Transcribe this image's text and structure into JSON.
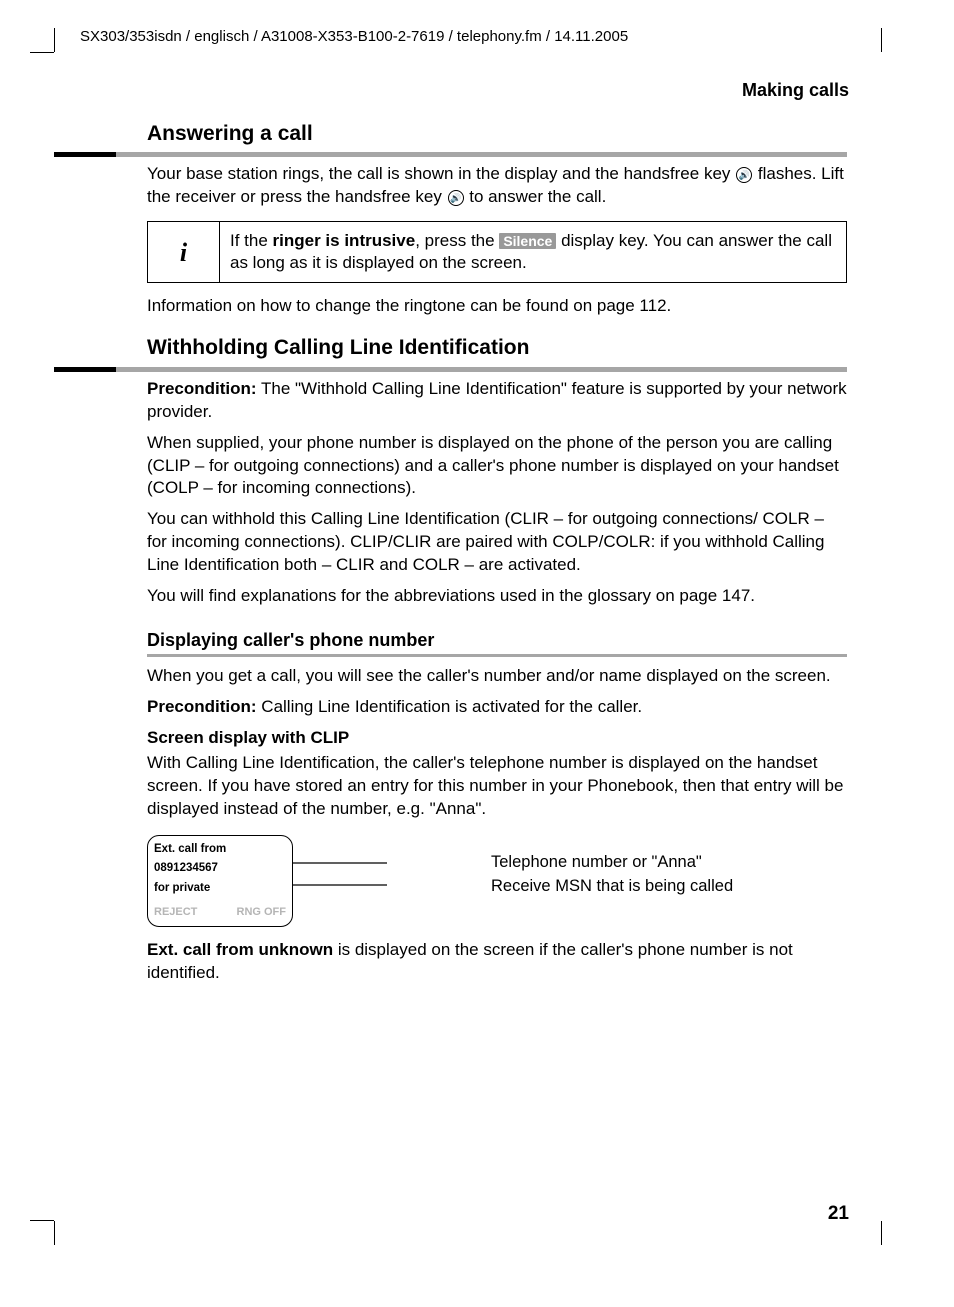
{
  "doc_header": "SX303/353isdn / englisch / A31008-X353-B100-2-7619 / telephony.fm / 14.11.2005",
  "chapter_title": "Making calls",
  "sec1": {
    "heading": "Answering a call",
    "p1a": "Your base station rings, the call is shown in the display and the handsfree key ",
    "p1b": " flashes. Lift the receiver or press the handsfree key ",
    "p1c": " to answer the call.",
    "info_a": "If the ",
    "info_bold": "ringer is intrusive",
    "info_b": ", press the ",
    "info_key": "Silence",
    "info_c": " display key. You can answer the call as long as it is displayed on the screen.",
    "p2": "Information on how to change the ringtone can be found on page 112."
  },
  "sec2": {
    "heading": "Withholding Calling Line Identification",
    "p1_label": "Precondition:",
    "p1": " The \"Withhold Calling Line Identification\" feature is supported by your network provider.",
    "p2": "When supplied, your phone number is displayed on the phone of the person you are calling (CLIP – for outgoing connections) and a caller's phone number is displayed on your handset (COLP – for incoming connections).",
    "p3": "You can withhold this Calling Line Identification (CLIR – for outgoing connections/ COLR – for incoming connections). CLIP/CLIR are paired with COLP/COLR: if you withhold Calling Line Identification both – CLIR and COLR – are activated.",
    "p4": "You will find explanations for the abbreviations used in the glossary on page 147."
  },
  "sec3": {
    "heading": "Displaying caller's phone number",
    "p1": "When you get a call, you will see the caller's number and/or name displayed on the screen.",
    "p2_label": "Precondition:",
    "p2": " Calling Line Identification is activated for the caller.",
    "sub_heading": "Screen display with CLIP",
    "p3": "With Calling Line Identification, the caller's telephone number is displayed on the handset screen. If you have stored an entry for this number in your Phonebook, then that entry will be displayed instead of the number, e.g. \"Anna\"."
  },
  "phone": {
    "line1": "Ext. call from",
    "line2": "0891234567",
    "line3": "for private",
    "soft_left": "REJECT",
    "soft_right": "RNG OFF"
  },
  "callouts": {
    "c1": "Telephone number or \"Anna\"",
    "c2": "Receive MSN that is being called"
  },
  "sec4": {
    "p1_bold": "Ext. call from unknown",
    "p1": " is displayed on the screen if the caller's phone number is not identified."
  },
  "page_number": "21"
}
